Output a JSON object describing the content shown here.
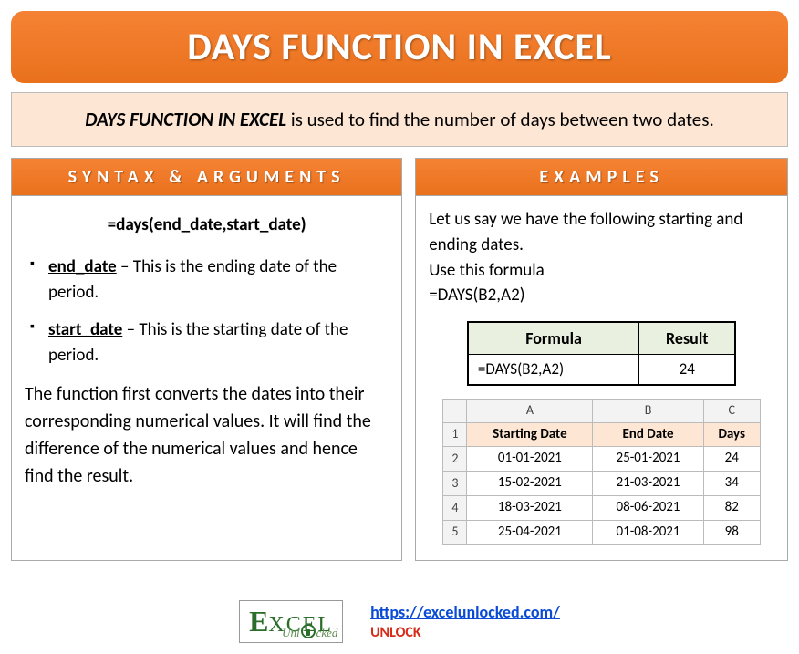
{
  "title": "DAYS FUNCTION IN EXCEL",
  "intro": {
    "strong": "DAYS FUNCTION IN EXCEL",
    "rest": " is used to find the number of days between two dates."
  },
  "syntax": {
    "header": "SYNTAX & ARGUMENTS",
    "formula": "=days(end_date,start_date)",
    "args": [
      {
        "name": "end_date",
        "desc": " – This is the ending date of the period."
      },
      {
        "name": "start_date",
        "desc": " – This is the starting date of the period."
      }
    ],
    "explain": "The function first converts the dates into their corresponding numerical values. It will find the difference of the numerical values and hence find the result."
  },
  "examples": {
    "header": "EXAMPLES",
    "intro_line1": "Let us say we have the following starting and ending dates.",
    "intro_line2": "Use this formula",
    "intro_line3": "=DAYS(B2,A2)",
    "fr_table": {
      "h1": "Formula",
      "h2": "Result",
      "formula": "=DAYS(B2,A2)",
      "result": "24"
    },
    "grid": {
      "cols": [
        "A",
        "B",
        "C"
      ],
      "head": [
        "Starting Date",
        "End Date",
        "Days"
      ],
      "rows": [
        [
          "01-01-2021",
          "25-01-2021",
          "24"
        ],
        [
          "15-02-2021",
          "21-03-2021",
          "34"
        ],
        [
          "18-03-2021",
          "08-06-2021",
          "82"
        ],
        [
          "25-04-2021",
          "01-08-2021",
          "98"
        ]
      ]
    }
  },
  "footer": {
    "logo_e": "E",
    "logo_xcel": "XCEL",
    "logo_unlocked": "Unl   cked",
    "url": "https://excelunlocked.com/",
    "unlock": "UNLOCK"
  }
}
